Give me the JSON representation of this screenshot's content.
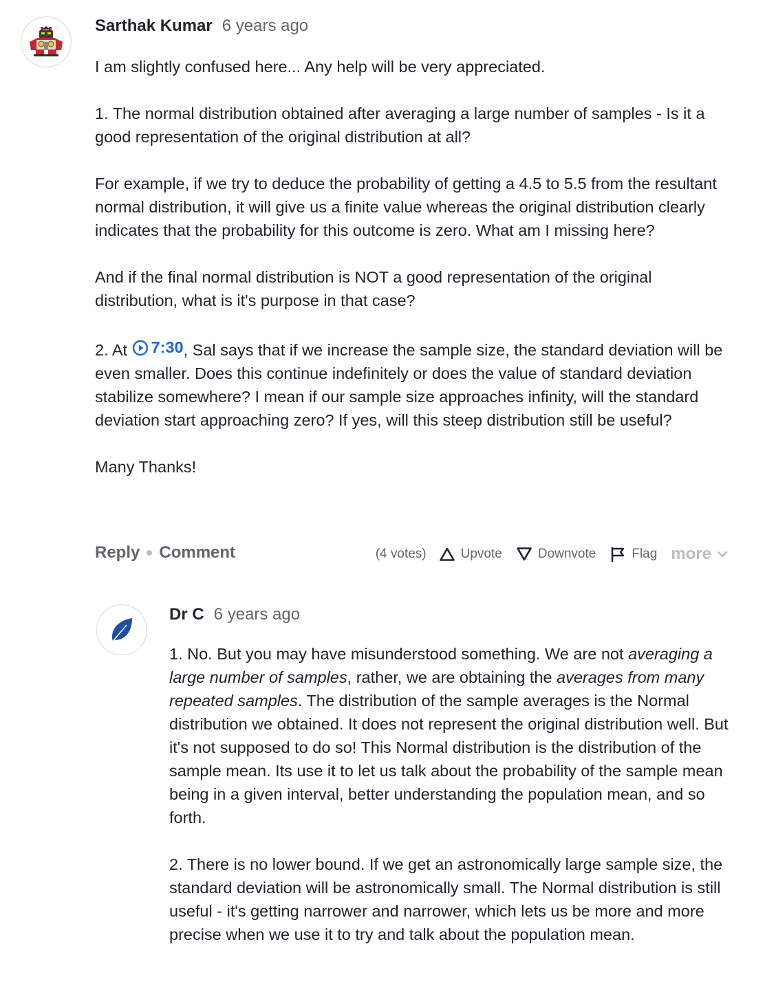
{
  "comment": {
    "author": "Sarthak Kumar",
    "time": "6 years ago",
    "avatar_icon": "robot-avatar-icon",
    "paragraphs": [
      "I am slightly confused here... Any help will be very appreciated.",
      "1. The normal distribution obtained after averaging a large number of samples - Is it a good representation of the original distribution at all?",
      "For example, if we try to deduce the probability of getting a 4.5 to 5.5 from the resultant normal distribution, it will give us a finite value whereas the original distribution clearly indicates that the probability for this outcome is zero. What am I missing here?",
      "And if the final normal distribution is NOT a good representation of the original distribution, what is it's purpose in that case?"
    ],
    "para5_prefix": "2. At ",
    "timestamp_link": "7:30",
    "para5_suffix": ", Sal says that if we increase the sample size, the standard deviation will be even smaller. Does this continue indefinitely or does the value of standard deviation stabilize somewhere? I mean if our sample size approaches infinity, will the standard deviation start approaching zero? If yes, will this steep distribution still be useful?",
    "closing": "Many Thanks!",
    "actions": {
      "reply": "Reply",
      "comment": "Comment",
      "votes": "(4 votes)",
      "upvote": "Upvote",
      "downvote": "Downvote",
      "flag": "Flag",
      "more": "more"
    }
  },
  "reply": {
    "author": "Dr C",
    "time": "6 years ago",
    "avatar_icon": "leaf-avatar-icon",
    "p1_a": "1. No. But you may have misunderstood something. We are not ",
    "p1_em1": "averaging a large number of samples",
    "p1_b": ", rather, we are obtaining the ",
    "p1_em2": "averages from many repeated samples",
    "p1_c": ". The distribution of the sample averages is the Normal distribution we obtained. It does not represent the original distribution well. But it's not supposed to do so! This Normal distribution is the distribution of the sample mean. Its use it to let us talk about the probability of the sample mean being in a given interval, better understanding the population mean, and so forth.",
    "p2": "2. There is no lower bound. If we get an astronomically large sample size, the standard deviation will be astronomically small. The Normal distribution is still useful - it's getting narrower and narrower, which lets us be more and more precise when we use it to try and talk about the population mean."
  },
  "colors": {
    "text": "#21242c",
    "muted": "#626569",
    "light": "#babec2",
    "link": "#1865f2",
    "leaf": "#1c4fa8"
  }
}
